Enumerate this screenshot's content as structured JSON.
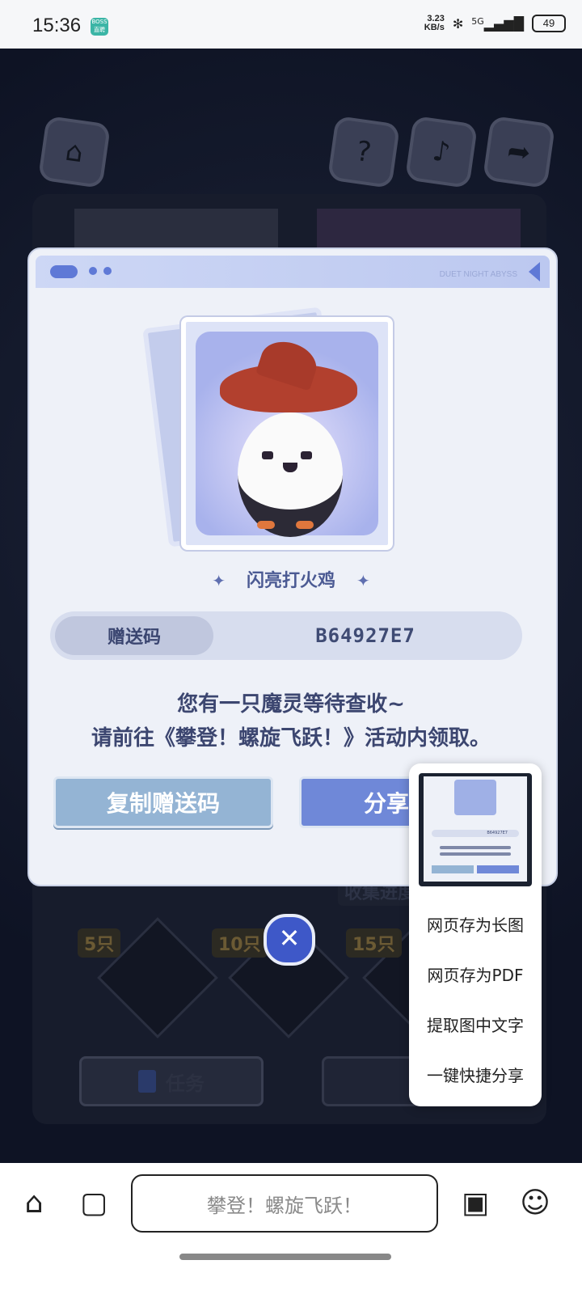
{
  "status_bar": {
    "time": "15:36",
    "boss_badge": "BOSS直聘",
    "speed_top": "3.23",
    "speed_unit": "KB/s",
    "network": "5G",
    "battery": "49"
  },
  "game": {
    "icons": [
      "home-icon",
      "help-icon",
      "music-icon",
      "share-icon"
    ],
    "milestones": [
      "5只",
      "10只",
      "15只"
    ],
    "task_label": "任务",
    "collect_label": "收集进度"
  },
  "dialog": {
    "brand": "DUET NIGHT ABYSS",
    "creature_name": "闪亮打火鸡",
    "code_label": "赠送码",
    "code_value": "B64927E7",
    "message_line1": "您有一只魔灵等待查收~",
    "message_line2": "请前往《攀登！螺旋飞跃！》活动内领取。",
    "copy_button": "复制赠送码",
    "share_button": "分享图片",
    "close_icon": "close-icon"
  },
  "popup_menu": {
    "thumb_code": "B64927E7",
    "items": [
      "网页存为长图",
      "网页存为PDF",
      "提取图中文字",
      "一键快捷分享"
    ]
  },
  "browser": {
    "url_text": "攀登！螺旋飞跃！",
    "nav": [
      "home-icon",
      "tabs-icon",
      "apps-icon",
      "assistant-icon"
    ]
  }
}
